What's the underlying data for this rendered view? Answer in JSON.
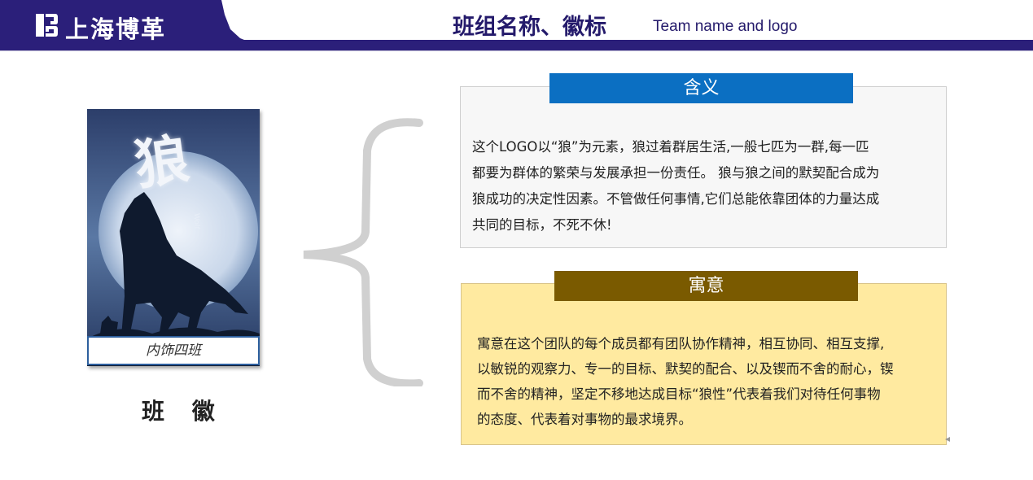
{
  "header": {
    "logo_text": "上海博革",
    "title": "班组名称、徽标",
    "subtitle": "Team name and logo",
    "colors": {
      "primary": "#2b1f7a"
    }
  },
  "emblem": {
    "glyph": "狼",
    "glyph_small": "Wolf",
    "caption": "内饰四班",
    "label": "班 徽"
  },
  "meaning": {
    "title": "含义",
    "lines": [
      "这个LOGO以“狼”为元素，狼过着群居生活,一般七匹为一群,每一匹",
      "都要为群体的繁荣与发展承担一份责任。 狼与狼之间的默契配合成为",
      "狼成功的决定性因素。不管做任何事情,它们总能依靠团体的力量达成",
      "共同的目标，不死不休!"
    ],
    "colors": {
      "title_bg": "#0b6fc2",
      "box_bg": "#f7f7f7"
    }
  },
  "implication": {
    "title": "寓意",
    "lines": [
      "寓意在这个团队的每个成员都有团队协作精神，相互协同、相互支撑,",
      "以敏锐的观察力、专一的目标、默契的配合、以及锲而不舍的耐心，锲",
      "而不舍的精神，坚定不移地达成目标“狼性”代表着我们对待任何事物",
      "的态度、代表着对事物的最求境界。"
    ],
    "colors": {
      "title_bg": "#7a5a00",
      "box_bg": "#ffeaa0"
    }
  }
}
